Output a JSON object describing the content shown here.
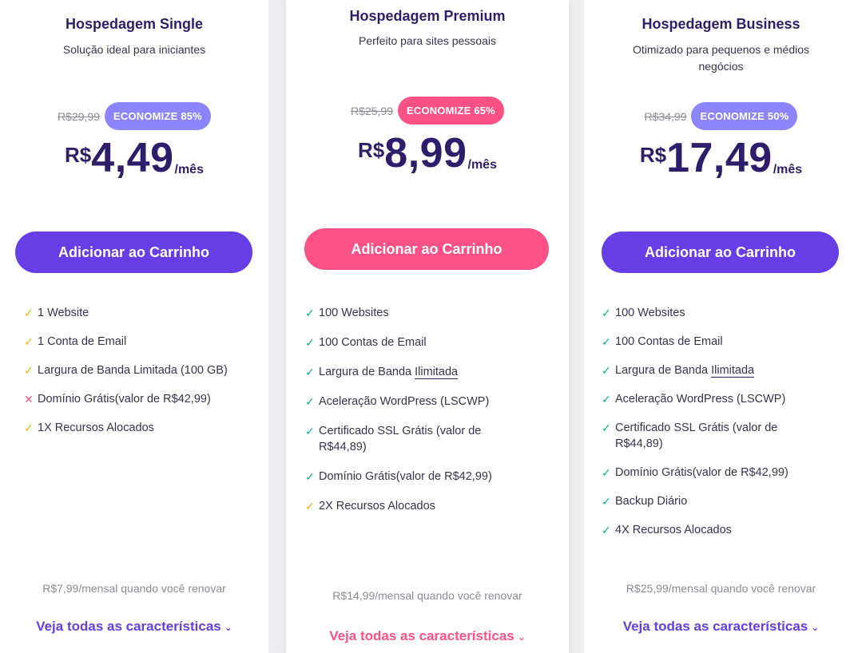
{
  "plans": [
    {
      "title": "Hospedagem Single",
      "subtitle": "Solução ideal para iniciantes",
      "old_price": "R$29,99",
      "discount": "ECONOMIZE 85%",
      "currency": "R$",
      "price": "4,49",
      "period": "/mês",
      "cart_label": "Adicionar ao Carrinho",
      "features": [
        {
          "icon": "check-icon",
          "text": "1 Website"
        },
        {
          "icon": "check-icon",
          "text": "1 Conta de Email"
        },
        {
          "icon": "check-icon",
          "text": "Largura de Banda Limitada (100 GB)"
        },
        {
          "icon": "cross-icon",
          "text": "Domínio Grátis(valor de R$42,99)"
        },
        {
          "icon": "check-icon",
          "text": "1X Recursos Alocados"
        }
      ],
      "renewal": "R$7,99/mensal quando você renovar",
      "see_all": "Veja todas as características"
    },
    {
      "title": "Hospedagem Premium",
      "subtitle": "Perfeito para sites pessoais",
      "old_price": "R$25,99",
      "discount": "ECONOMIZE 65%",
      "currency": "R$",
      "price": "8,99",
      "period": "/mês",
      "cart_label": "Adicionar ao Carrinho",
      "features": [
        {
          "icon": "check-icon",
          "text": "100 Websites"
        },
        {
          "icon": "check-icon",
          "text": "100 Contas de Email"
        },
        {
          "icon": "check-icon",
          "text_prefix": "Largura de Banda ",
          "text_highlight": "Ilimitada"
        },
        {
          "icon": "check-icon",
          "text": "Aceleração WordPress (LSCWP)"
        },
        {
          "icon": "check-icon",
          "text": "Certificado SSL Grátis (valor de R$44,89)"
        },
        {
          "icon": "check-icon",
          "text": "Domínio Grátis(valor de R$42,99)"
        },
        {
          "icon": "check-icon",
          "text": "2X Recursos Alocados"
        }
      ],
      "renewal": "R$14,99/mensal quando você renovar",
      "see_all": "Veja todas as características"
    },
    {
      "title": "Hospedagem Business",
      "subtitle": "Otimizado para pequenos e médios negócios",
      "old_price": "R$34,99",
      "discount": "ECONOMIZE 50%",
      "currency": "R$",
      "price": "17,49",
      "period": "/mês",
      "cart_label": "Adicionar ao Carrinho",
      "features": [
        {
          "icon": "check-icon",
          "text": "100 Websites"
        },
        {
          "icon": "check-icon",
          "text": "100 Contas de Email"
        },
        {
          "icon": "check-icon",
          "text_prefix": "Largura de Banda ",
          "text_highlight": "Ilimitada"
        },
        {
          "icon": "check-icon",
          "text": "Aceleração WordPress (LSCWP)"
        },
        {
          "icon": "check-icon",
          "text": "Certificado SSL Grátis (valor de R$44,89)"
        },
        {
          "icon": "check-icon",
          "text": "Domínio Grátis(valor de R$42,99)"
        },
        {
          "icon": "check-icon",
          "text": "Backup Diário"
        },
        {
          "icon": "check-icon",
          "text": "4X Recursos Alocados"
        }
      ],
      "renewal": "R$25,99/mensal quando você renovar",
      "see_all": "Veja todas as características"
    }
  ],
  "colors": {
    "brand_purple": "#673de6",
    "badge_purple": "#8c85ff",
    "brand_pink": "#fc5185",
    "heading": "#2f1c6a",
    "check_green": "#00b090",
    "check_orange": "#ffad00",
    "muted": "#8c8a97"
  }
}
